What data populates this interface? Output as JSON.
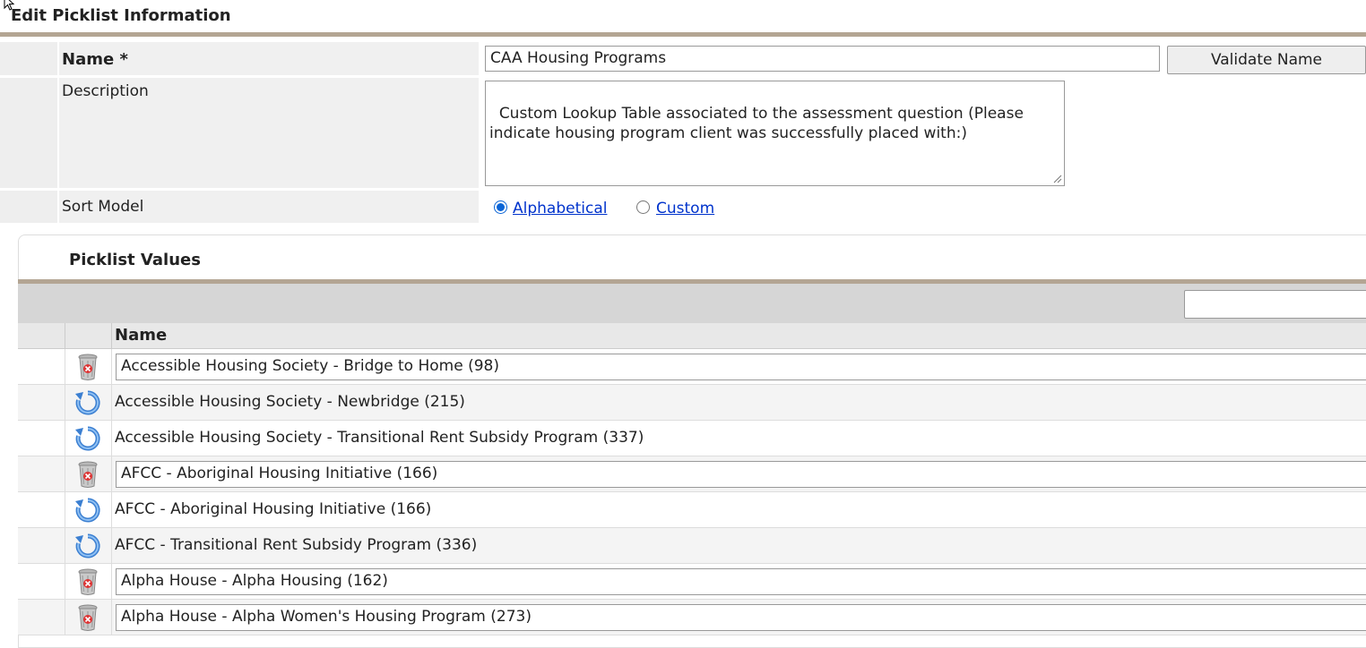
{
  "page": {
    "title": "Edit Picklist Information"
  },
  "form": {
    "name_label": "Name",
    "name_required_mark": "*",
    "name_value": "CAA Housing Programs",
    "validate_button": "Validate Name",
    "description_label": "Description",
    "description_value": "Custom Lookup Table associated to the assessment question (Please\nindicate housing program client was successfully placed with:)",
    "sort_model_label": "Sort Model",
    "sort_options": [
      {
        "label": "Alphabetical",
        "selected": true
      },
      {
        "label": "Custom",
        "selected": false
      }
    ]
  },
  "picklist": {
    "title": "Picklist Values",
    "filter_value": "",
    "column_name": "Name",
    "rows": [
      {
        "value": "Accessible Housing Society - Bridge to Home (98)",
        "icon": "trash-icon",
        "editable": true
      },
      {
        "value": "Accessible Housing Society - Newbridge (215)",
        "icon": "restore-icon",
        "editable": false
      },
      {
        "value": "Accessible Housing Society - Transitional Rent Subsidy Program (337)",
        "icon": "restore-icon",
        "editable": false
      },
      {
        "value": "AFCC - Aboriginal Housing Initiative (166)",
        "icon": "trash-icon",
        "editable": true
      },
      {
        "value": "AFCC - Aboriginal Housing Initiative (166)",
        "icon": "restore-icon",
        "editable": false
      },
      {
        "value": "AFCC - Transitional Rent Subsidy Program (336)",
        "icon": "restore-icon",
        "editable": false
      },
      {
        "value": "Alpha House -  Alpha Housing (162)",
        "icon": "trash-icon",
        "editable": true
      },
      {
        "value": "Alpha House - Alpha Women's Housing Program (273)",
        "icon": "trash-icon",
        "editable": true
      }
    ]
  },
  "colors": {
    "accent_rule": "#b3a593",
    "link": "#0033cc",
    "radio_selected": "#0a64d6"
  }
}
